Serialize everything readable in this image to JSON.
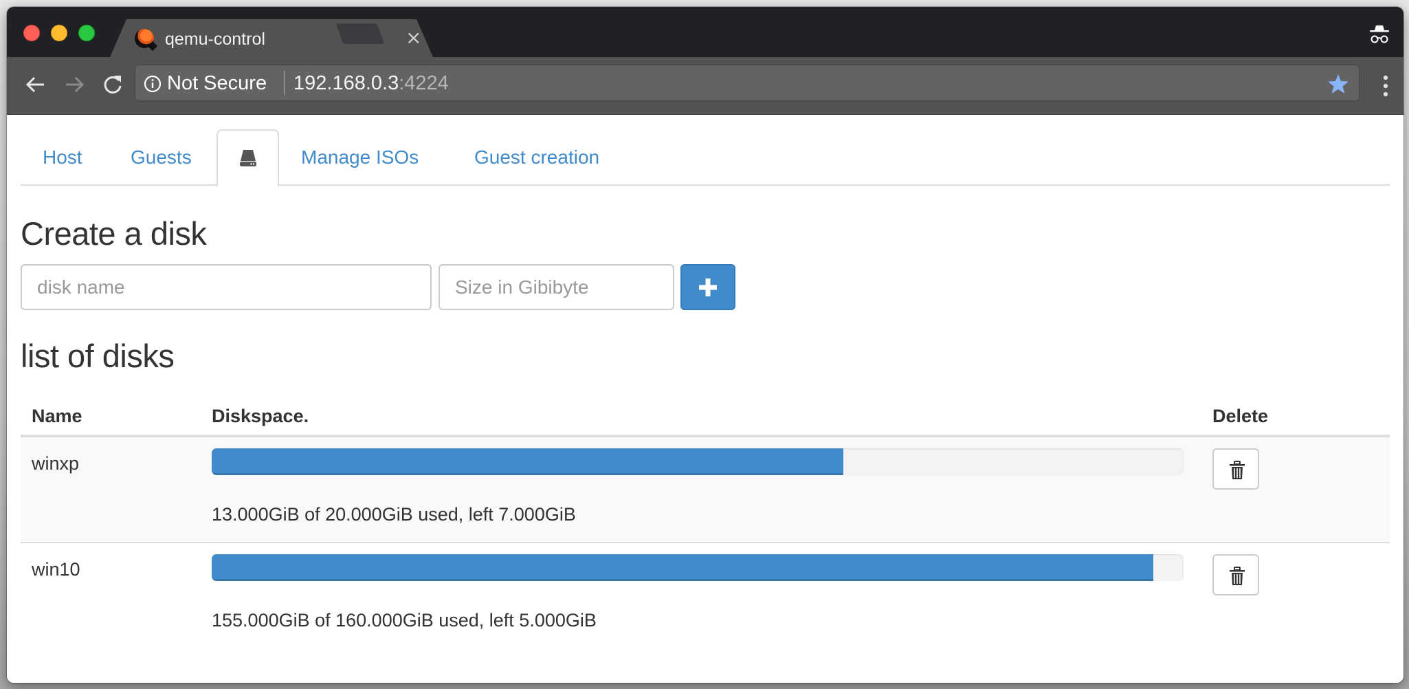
{
  "browser": {
    "tab_title": "qemu-control",
    "tab_close_glyph": "×",
    "security_label": "Not Secure",
    "url_host": "192.168.0.3",
    "url_port": ":4224",
    "icons": {
      "back": "arrow-left-icon",
      "forward": "arrow-right-icon",
      "reload": "reload-icon",
      "info": "info-icon",
      "bookmark": "star-icon",
      "menu": "kebab-menu-icon",
      "incognito": "incognito-icon"
    },
    "colors": {
      "bookmark_star": "#8ab4f8"
    }
  },
  "nav": {
    "tabs": [
      {
        "label": "Host",
        "active": false
      },
      {
        "label": "Guests",
        "active": false
      },
      {
        "label": "",
        "icon": "hdd-icon",
        "active": true
      },
      {
        "label": "Manage ISOs",
        "active": false
      },
      {
        "label": "Guest creation",
        "active": false
      }
    ],
    "link_color": "#428bca"
  },
  "create": {
    "title": "Create a disk",
    "name_placeholder": "disk name",
    "name_value": "",
    "size_placeholder": "Size in Gibibyte",
    "size_value": "",
    "add_button_icon": "plus-icon",
    "primary_color": "#428bca"
  },
  "list": {
    "title": "list of disks",
    "columns": [
      "Name",
      "Diskspace.",
      "Delete"
    ],
    "disks": [
      {
        "name": "winxp",
        "used_gib": 13.0,
        "total_gib": 20.0,
        "left_gib": 7.0,
        "used_fraction": 0.65,
        "usage_text": "13.000GiB of 20.000GiB used, left 7.000GiB"
      },
      {
        "name": "win10",
        "used_gib": 155.0,
        "total_gib": 160.0,
        "left_gib": 5.0,
        "used_fraction": 0.96875,
        "usage_text": "155.000GiB of 160.000GiB used, left 5.000GiB"
      }
    ],
    "delete_icon": "trash-icon"
  }
}
